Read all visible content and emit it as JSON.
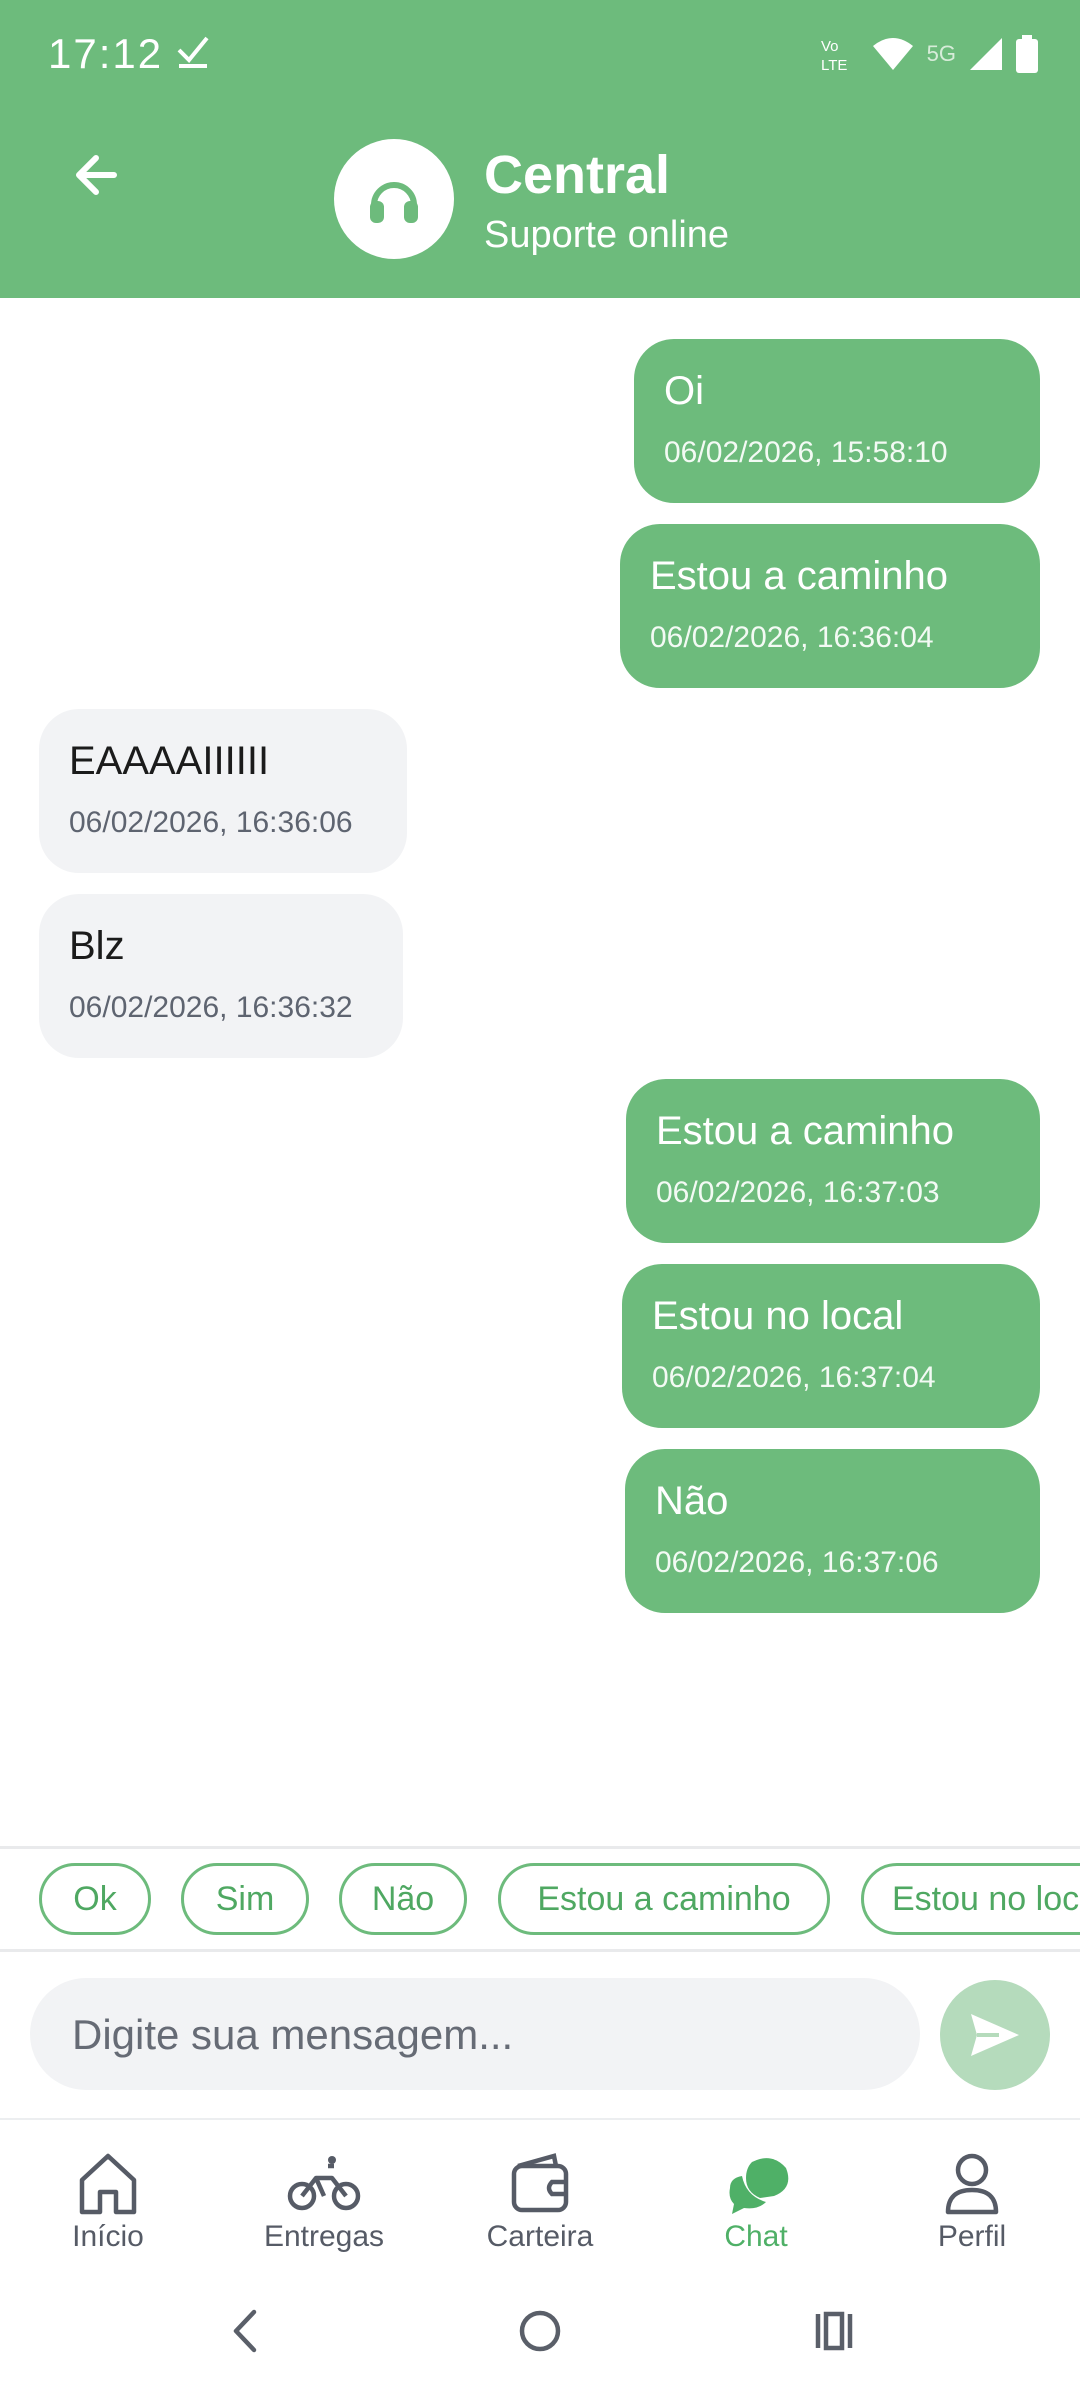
{
  "status_bar": {
    "time": "17:12",
    "network": "5G"
  },
  "header": {
    "title": "Central",
    "subtitle": "Suporte online"
  },
  "colors": {
    "primary": "#6dbb7c",
    "received_bubble": "#f2f3f5",
    "send_disabled": "#b5dbbc"
  },
  "messages": [
    {
      "direction": "sent",
      "text": "Oi",
      "time": "06/02/2026, 15:58:10"
    },
    {
      "direction": "sent",
      "text": "Estou a caminho",
      "time": "06/02/2026, 16:36:04"
    },
    {
      "direction": "received",
      "text": "EAAAAIIIIII",
      "time": "06/02/2026, 16:36:06"
    },
    {
      "direction": "received",
      "text": "Blz",
      "time": "06/02/2026, 16:36:32"
    },
    {
      "direction": "sent",
      "text": "Estou a caminho",
      "time": "06/02/2026, 16:37:03"
    },
    {
      "direction": "sent",
      "text": "Estou no local",
      "time": "06/02/2026, 16:37:04"
    },
    {
      "direction": "sent",
      "text": "Não",
      "time": "06/02/2026, 16:37:06"
    }
  ],
  "quick_replies": [
    "Ok",
    "Sim",
    "Não",
    "Estou a caminho",
    "Estou no local"
  ],
  "composer": {
    "placeholder": "Digite sua mensagem..."
  },
  "bottom_nav": [
    {
      "label": "Início",
      "icon": "home-icon",
      "active": false
    },
    {
      "label": "Entregas",
      "icon": "bike-icon",
      "active": false
    },
    {
      "label": "Carteira",
      "icon": "wallet-icon",
      "active": false
    },
    {
      "label": "Chat",
      "icon": "chat-icon",
      "active": true
    },
    {
      "label": "Perfil",
      "icon": "user-icon",
      "active": false
    }
  ]
}
